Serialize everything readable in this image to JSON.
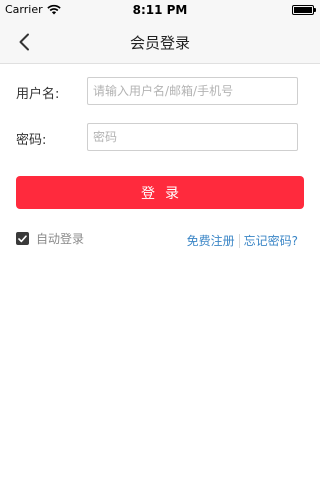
{
  "status_bar": {
    "carrier": "Carrier",
    "time": "8:11 PM",
    "battery_level": 1.0
  },
  "nav": {
    "title": "会员登录",
    "back_icon": "chevron-left-icon"
  },
  "form": {
    "username_label": "用户名:",
    "username_placeholder": "请输入用户名/邮箱/手机号",
    "password_label": "密码:",
    "password_placeholder": "密码"
  },
  "login_button": "登录",
  "auto_login": {
    "label": "自动登录",
    "checked": true
  },
  "links": {
    "register": "免费注册",
    "forgot_password": "忘记密码?"
  },
  "colors": {
    "accent": "#ff2a3d",
    "link": "#3b86c6"
  }
}
